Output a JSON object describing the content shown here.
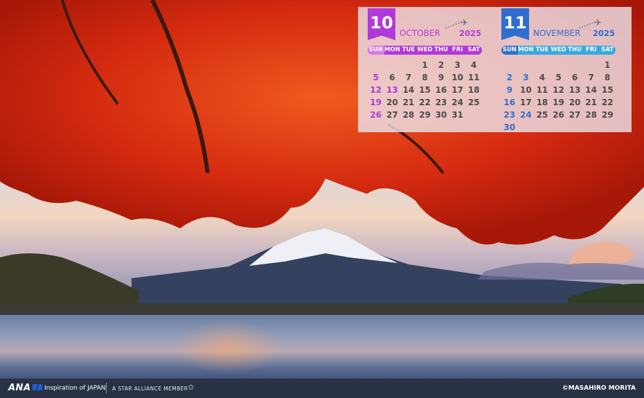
{
  "calendar": {
    "months": [
      {
        "number": "10",
        "name": "OCTOBER",
        "year": "2025",
        "weekdays": [
          "SUN",
          "MON",
          "TUE",
          "WED",
          "THU",
          "FRI",
          "SAT"
        ],
        "first_weekday": 3,
        "days": 31,
        "holidays": [
          13
        ]
      },
      {
        "number": "11",
        "name": "NOVEMBER",
        "year": "2025",
        "weekdays": [
          "SUN",
          "MON",
          "TUE",
          "WED",
          "THU",
          "FRI",
          "SAT"
        ],
        "first_weekday": 6,
        "days": 30,
        "holidays": [
          3,
          24
        ]
      }
    ],
    "plane_icon": "airplane-icon"
  },
  "footer": {
    "brand": "ANA",
    "tagline": "Inspiration of JAPAN",
    "alliance": "A STAR ALLIANCE MEMBER",
    "copyright": "©MASAHIRO MORITA"
  },
  "colors": {
    "october_accent": "#b03ad9",
    "november_accent": "#2f6ed0",
    "november_weekday_bar": "#3aa8df"
  }
}
